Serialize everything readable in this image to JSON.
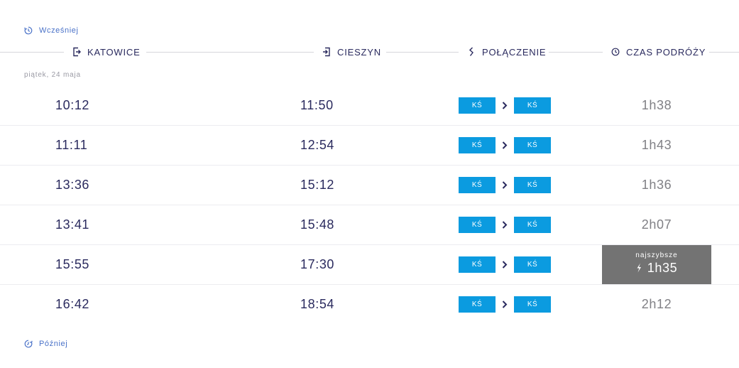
{
  "nav": {
    "earlier_label": "Wcześniej",
    "later_label": "Później"
  },
  "header": {
    "from_label": "KATOWICE",
    "to_label": "CIESZYN",
    "connection_label": "POŁĄCZENIE",
    "duration_label": "CZAS PODRÓŻY"
  },
  "date_label": "piątek, 24 maja",
  "fastest_label": "najszybsze",
  "colors": {
    "accent": "#4a72c8",
    "text_dark": "#2a2a5e",
    "badge_blue": "#0b9be0",
    "fastest_bg": "#737373",
    "duration_gray": "#808085"
  },
  "connections": [
    {
      "departure": "10:12",
      "arrival": "11:50",
      "carrier_1": "KŚ",
      "carrier_2": "KŚ",
      "duration": "1h38",
      "fastest": false
    },
    {
      "departure": "11:11",
      "arrival": "12:54",
      "carrier_1": "KŚ",
      "carrier_2": "KŚ",
      "duration": "1h43",
      "fastest": false
    },
    {
      "departure": "13:36",
      "arrival": "15:12",
      "carrier_1": "KŚ",
      "carrier_2": "KŚ",
      "duration": "1h36",
      "fastest": false
    },
    {
      "departure": "13:41",
      "arrival": "15:48",
      "carrier_1": "KŚ",
      "carrier_2": "KŚ",
      "duration": "2h07",
      "fastest": false
    },
    {
      "departure": "15:55",
      "arrival": "17:30",
      "carrier_1": "KŚ",
      "carrier_2": "KŚ",
      "duration": "1h35",
      "fastest": true
    },
    {
      "departure": "16:42",
      "arrival": "18:54",
      "carrier_1": "KŚ",
      "carrier_2": "KŚ",
      "duration": "2h12",
      "fastest": false
    }
  ]
}
